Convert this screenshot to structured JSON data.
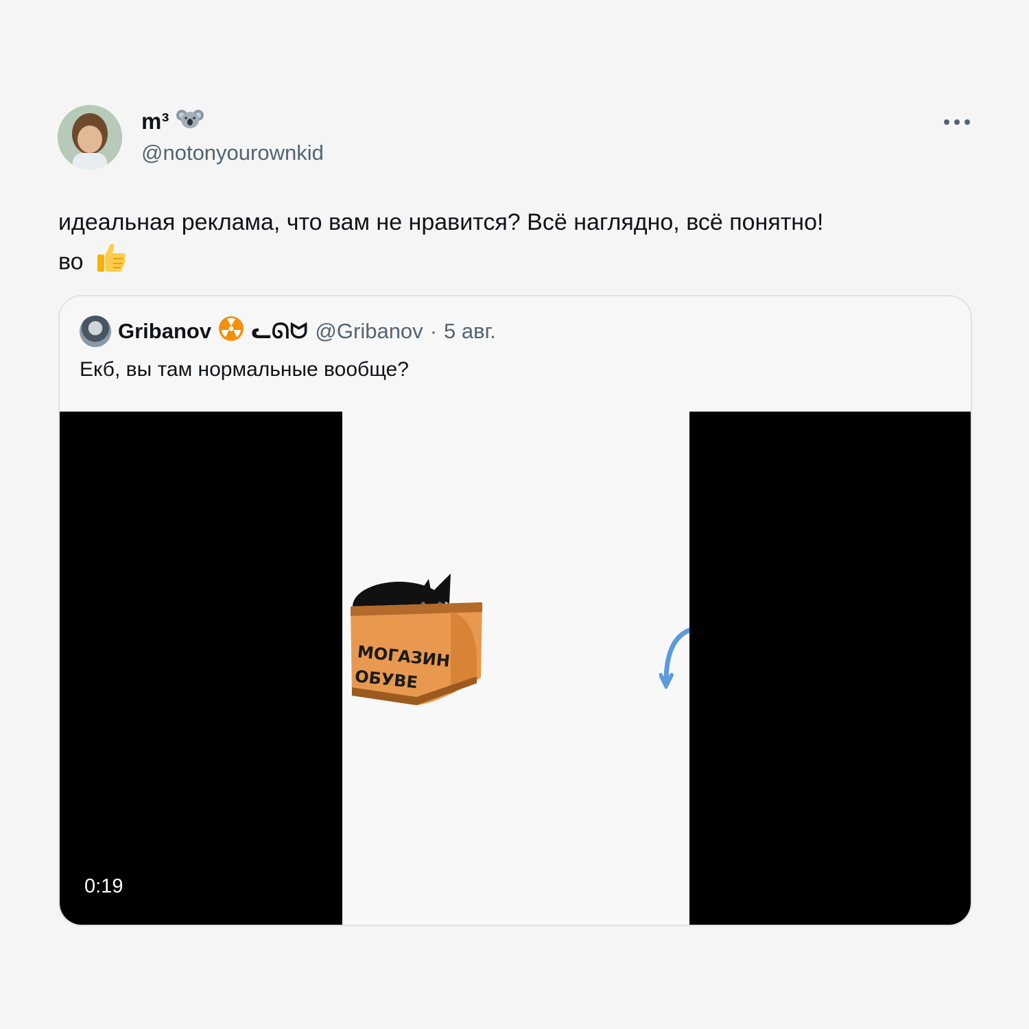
{
  "tweet": {
    "author": {
      "display_name": "m³",
      "name_emoji": "koala",
      "handle": "@notonyourownkid"
    },
    "more_label": "•••",
    "text_line_1": "идеальная реклама, что вам не нравится? Всё наглядно, всё понятно!",
    "text_line_2": "во",
    "text_emoji": "thumbs-up"
  },
  "quoted_tweet": {
    "display_name": "Gribanov",
    "name_emoji": "radioactive",
    "name_glyphs": "ᓚᘏᗢ",
    "handle": "@Gribanov",
    "separator": "·",
    "date": "5 авг.",
    "text": "Екб, вы там нормальные вообще?",
    "media": {
      "type": "video",
      "duration": "0:19",
      "sticker_line_1": "МОГАЗИН",
      "sticker_line_2": "ОБУВЕ"
    }
  },
  "colors": {
    "background": "#f5f5f5",
    "text": "#0f1419",
    "secondary_text": "#536471",
    "card_border": "#dde3e8",
    "video_bars": "#000000"
  }
}
